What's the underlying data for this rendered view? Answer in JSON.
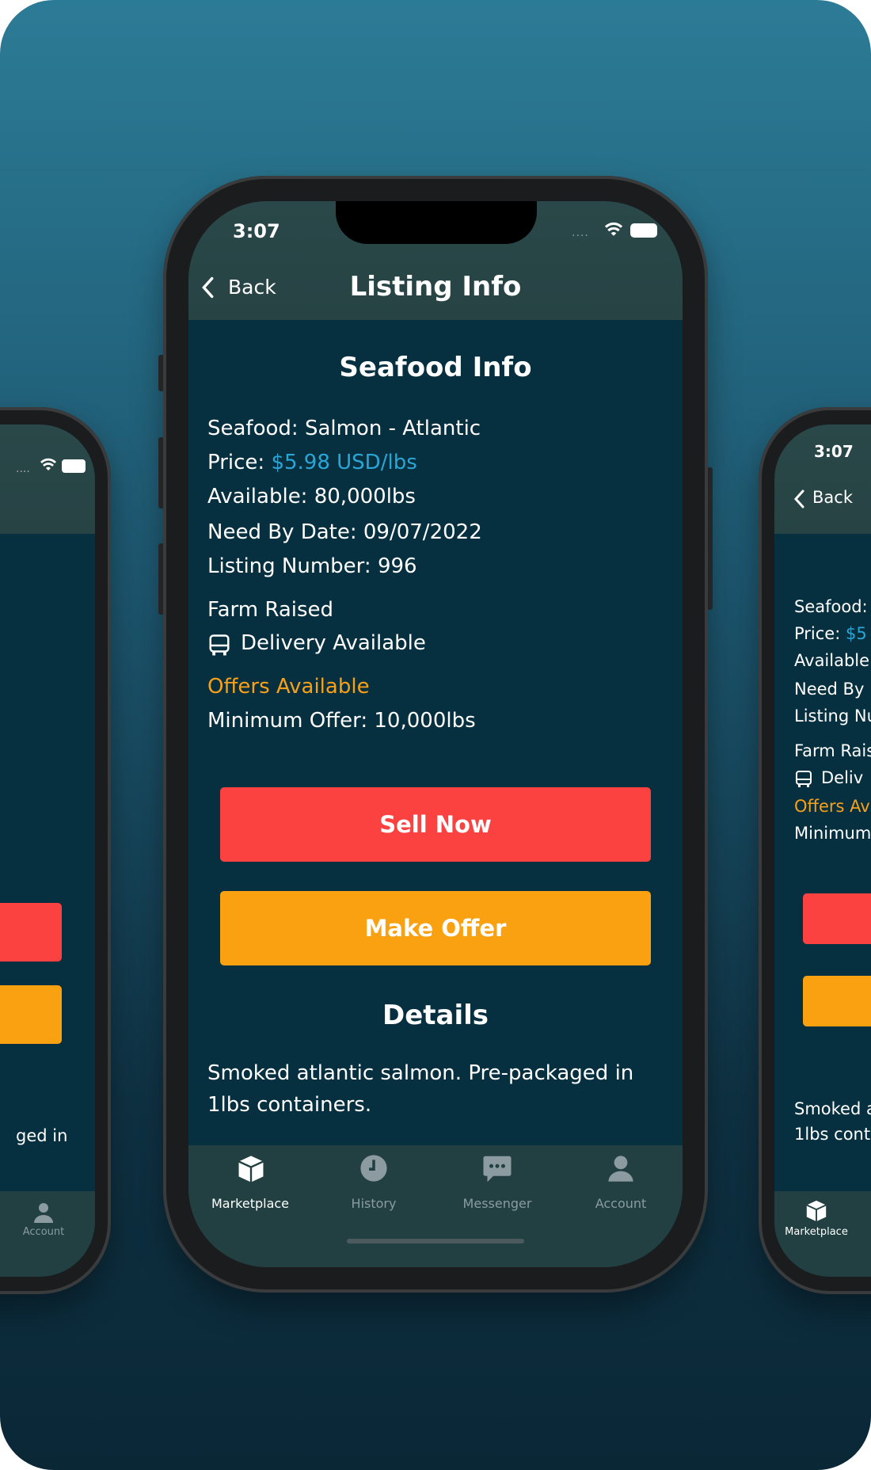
{
  "status": {
    "time": "3:07"
  },
  "nav": {
    "back": "Back",
    "title": "Listing Info"
  },
  "section_title": "Seafood Info",
  "fields": [
    {
      "label": "Seafood:",
      "value": "Salmon - Atlantic"
    },
    {
      "label": "Price:",
      "value": "$5.98 USD/lbs"
    },
    {
      "label": "Available:",
      "value": "80,000lbs"
    },
    {
      "label": "Need By Date:",
      "value": "09/07/2022"
    },
    {
      "label": "Listing Number:",
      "value": "996"
    }
  ],
  "farm_raised": "Farm Raised",
  "delivery": "Delivery Available",
  "offers_available": "Offers Available",
  "minimum_offer": {
    "label": "Minimum Offer:",
    "value": "10,000lbs"
  },
  "buttons": {
    "sell": "Sell Now",
    "offer": "Make Offer"
  },
  "details": {
    "title": "Details",
    "text_line1": "Smoked atlantic salmon. Pre-packaged in",
    "text_line2": "1lbs containers."
  },
  "tabs": [
    "Marketplace",
    "History",
    "Messenger",
    "Account"
  ],
  "left_phone": {
    "details_fragment": "ged in",
    "tab": "Account"
  },
  "right_phone": {
    "time": "3:07",
    "back": "Back",
    "labels": [
      "Seafood:",
      "Price:",
      "Available",
      "Need By",
      "Listing Nu"
    ],
    "price_fragment": "$5",
    "farm_fragment": "Farm Rais",
    "delivery_fragment": "Deliv",
    "offers_fragment": "Offers Av",
    "minimum_fragment": "Minimum",
    "details_line1": "Smoked a",
    "details_line2": "1lbs cont",
    "tab": "Marketplace"
  },
  "colors": {
    "accent": "#2aa6d6",
    "orange": "#f8a118",
    "sell_button": "#fb4240",
    "offer_button": "#f9a111",
    "screen_bg": "#063040"
  }
}
